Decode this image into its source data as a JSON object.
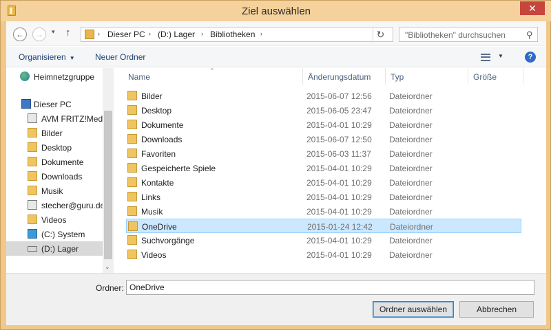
{
  "window": {
    "title": "Ziel auswählen",
    "close_glyph": "✕"
  },
  "nav": {
    "back_glyph": "←",
    "forward_glyph": "→",
    "history_glyph": "▾",
    "up_glyph": "↑",
    "breadcrumbs": [
      "Dieser PC",
      "(D:) Lager",
      "Bibliotheken"
    ],
    "crumb_sep": "›",
    "refresh_glyph": "↻",
    "search_placeholder": "\"Bibliotheken\" durchsuchen",
    "search_glyph": "⚲"
  },
  "toolbar": {
    "organize_label": "Organisieren",
    "organize_caret": "▼",
    "new_folder_label": "Neuer Ordner",
    "view_caret": "▼",
    "help_glyph": "?"
  },
  "sidebar": {
    "items": [
      {
        "label": "Heimnetzgruppe",
        "icon": "homegroup-icon"
      },
      {
        "label": "Dieser PC",
        "icon": "computer-icon"
      },
      {
        "label": "AVM FRITZ!Media",
        "icon": "media-device-icon"
      },
      {
        "label": "Bilder",
        "icon": "folder-icon"
      },
      {
        "label": "Desktop",
        "icon": "folder-icon"
      },
      {
        "label": "Dokumente",
        "icon": "folder-icon"
      },
      {
        "label": "Downloads",
        "icon": "folder-icon"
      },
      {
        "label": "Musik",
        "icon": "folder-icon"
      },
      {
        "label": "stecher@guru.de",
        "icon": "media-device-icon"
      },
      {
        "label": "Videos",
        "icon": "folder-icon"
      },
      {
        "label": "(C:) System",
        "icon": "system-drive-icon"
      },
      {
        "label": "(D:) Lager",
        "icon": "drive-icon",
        "selected": true
      }
    ],
    "scroll_down_glyph": "⌄"
  },
  "filelist": {
    "columns": {
      "name": "Name",
      "date": "Änderungsdatum",
      "type": "Typ",
      "size": "Größe"
    },
    "sort_glyph": "^",
    "rows": [
      {
        "name": "Bilder",
        "date": "2015-06-07 12:56",
        "type": "Dateiordner"
      },
      {
        "name": "Desktop",
        "date": "2015-06-05 23:47",
        "type": "Dateiordner"
      },
      {
        "name": "Dokumente",
        "date": "2015-04-01 10:29",
        "type": "Dateiordner"
      },
      {
        "name": "Downloads",
        "date": "2015-06-07 12:50",
        "type": "Dateiordner"
      },
      {
        "name": "Favoriten",
        "date": "2015-06-03 11:37",
        "type": "Dateiordner"
      },
      {
        "name": "Gespeicherte Spiele",
        "date": "2015-04-01 10:29",
        "type": "Dateiordner"
      },
      {
        "name": "Kontakte",
        "date": "2015-04-01 10:29",
        "type": "Dateiordner"
      },
      {
        "name": "Links",
        "date": "2015-04-01 10:29",
        "type": "Dateiordner"
      },
      {
        "name": "Musik",
        "date": "2015-04-01 10:29",
        "type": "Dateiordner"
      },
      {
        "name": "OneDrive",
        "date": "2015-01-24 12:42",
        "type": "Dateiordner",
        "selected": true
      },
      {
        "name": "Suchvorgänge",
        "date": "2015-04-01 10:29",
        "type": "Dateiordner"
      },
      {
        "name": "Videos",
        "date": "2015-04-01 10:29",
        "type": "Dateiordner"
      }
    ]
  },
  "footer": {
    "folder_label": "Ordner:",
    "folder_value": "OneDrive",
    "ok_label": "Ordner auswählen",
    "cancel_label": "Abbrechen"
  }
}
